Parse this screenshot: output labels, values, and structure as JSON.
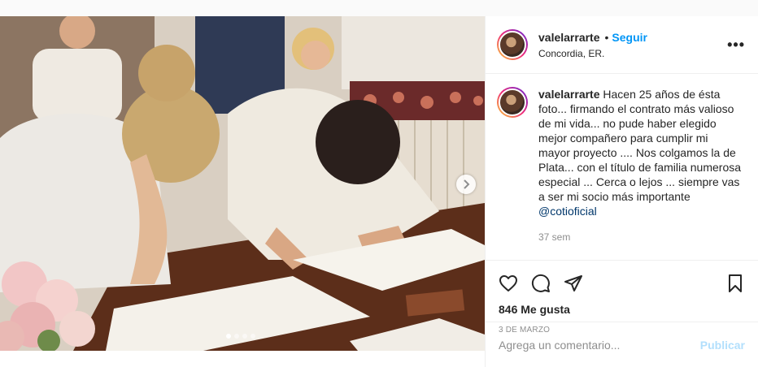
{
  "post": {
    "author": {
      "username": "valelarrarte",
      "separator": "•",
      "follow_label": "Seguir",
      "location": "Concordia, ER.",
      "more_label": "•••"
    },
    "caption": {
      "username": "valelarrarte",
      "text": "Hacen 25 años de ésta foto... firmando el contrato más valioso de mi vida... no pude haber elegido mejor compañero para cumplir mi mayor proyecto .... Nos colgamos la de Plata... con el título de familia numerosa especial ... Cerca o lejos ... siempre vas a ser mi socio más importante ",
      "mention": "@cotioficial",
      "time": "37 sem"
    },
    "actions": {
      "like_icon": "heart-icon",
      "comment_icon": "comment-icon",
      "share_icon": "send-icon",
      "save_icon": "bookmark-icon"
    },
    "likes": "846 Me gusta",
    "date": "3 DE MARZO",
    "comment": {
      "placeholder": "Agrega un comentario...",
      "publish_label": "Publicar"
    },
    "carousel": {
      "slides": 4,
      "active": 0
    }
  },
  "colors": {
    "accent": "#0095f6",
    "publish_disabled": "#b2dffc",
    "border": "#efefef",
    "muted": "#8e8e8e"
  }
}
